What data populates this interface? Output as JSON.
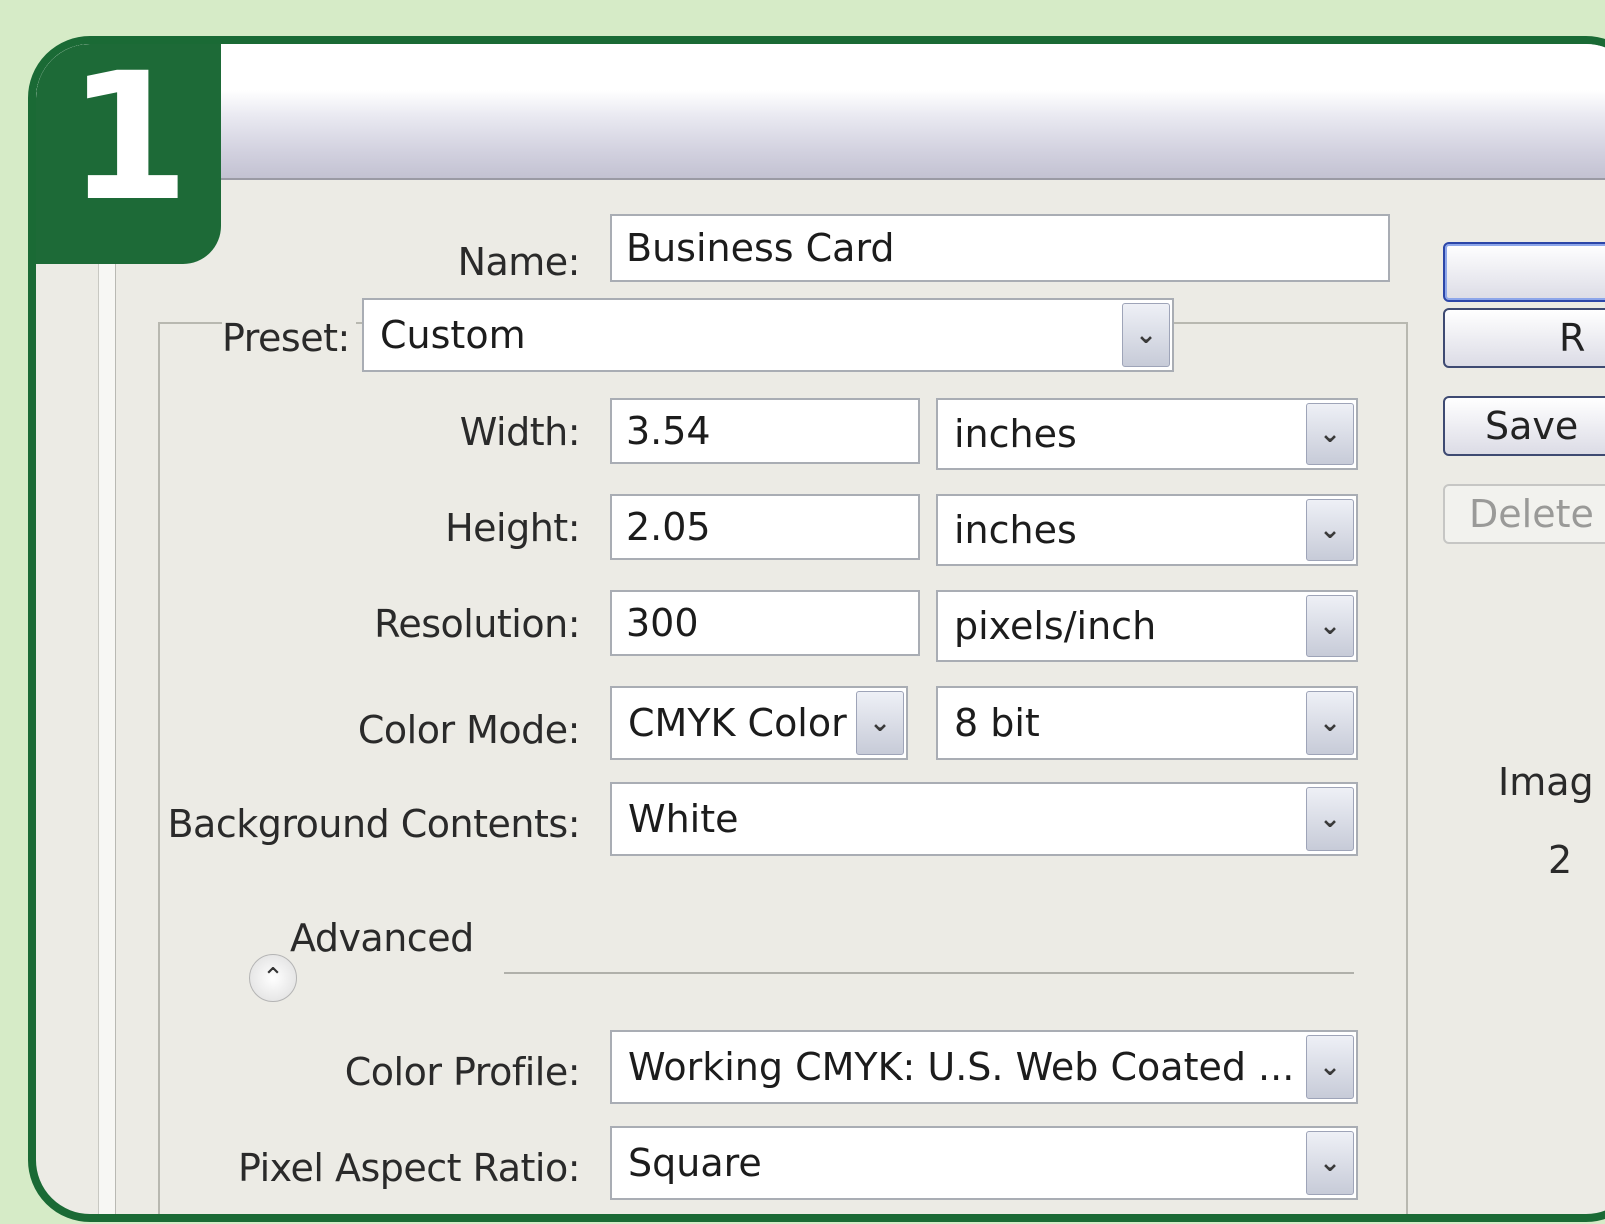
{
  "step": {
    "number": "1"
  },
  "dialog": {
    "name_label": "Name:",
    "name_value": "Business Card",
    "preset_label": "Preset:",
    "preset_value": "Custom",
    "width_label": "Width:",
    "width_value": "3.54",
    "width_unit": "inches",
    "height_label": "Height:",
    "height_value": "2.05",
    "height_unit": "inches",
    "resolution_label": "Resolution:",
    "resolution_value": "300",
    "resolution_unit": "pixels/inch",
    "color_mode_label": "Color Mode:",
    "color_mode_value": "CMYK Color",
    "bit_depth_value": "8 bit",
    "background_label": "Background Contents:",
    "background_value": "White",
    "advanced_label": "Advanced",
    "color_profile_label": "Color Profile:",
    "color_profile_value": "Working CMYK:  U.S. Web Coated ...",
    "pixel_aspect_label": "Pixel Aspect Ratio:",
    "pixel_aspect_value": "Square"
  },
  "buttons": {
    "ok_label": "",
    "reset_label": "R",
    "save_label": "Save",
    "delete_label": "Delete"
  },
  "side": {
    "image_size_label": "Imag",
    "image_size_value": "2"
  },
  "icons": {
    "dropdown": "chevron-down-icon",
    "advanced_toggle": "double-chevron-up-icon"
  },
  "colors": {
    "accent_green": "#1d6a37",
    "page_background": "#d6ebc7",
    "dialog_background": "#ecebe5"
  }
}
